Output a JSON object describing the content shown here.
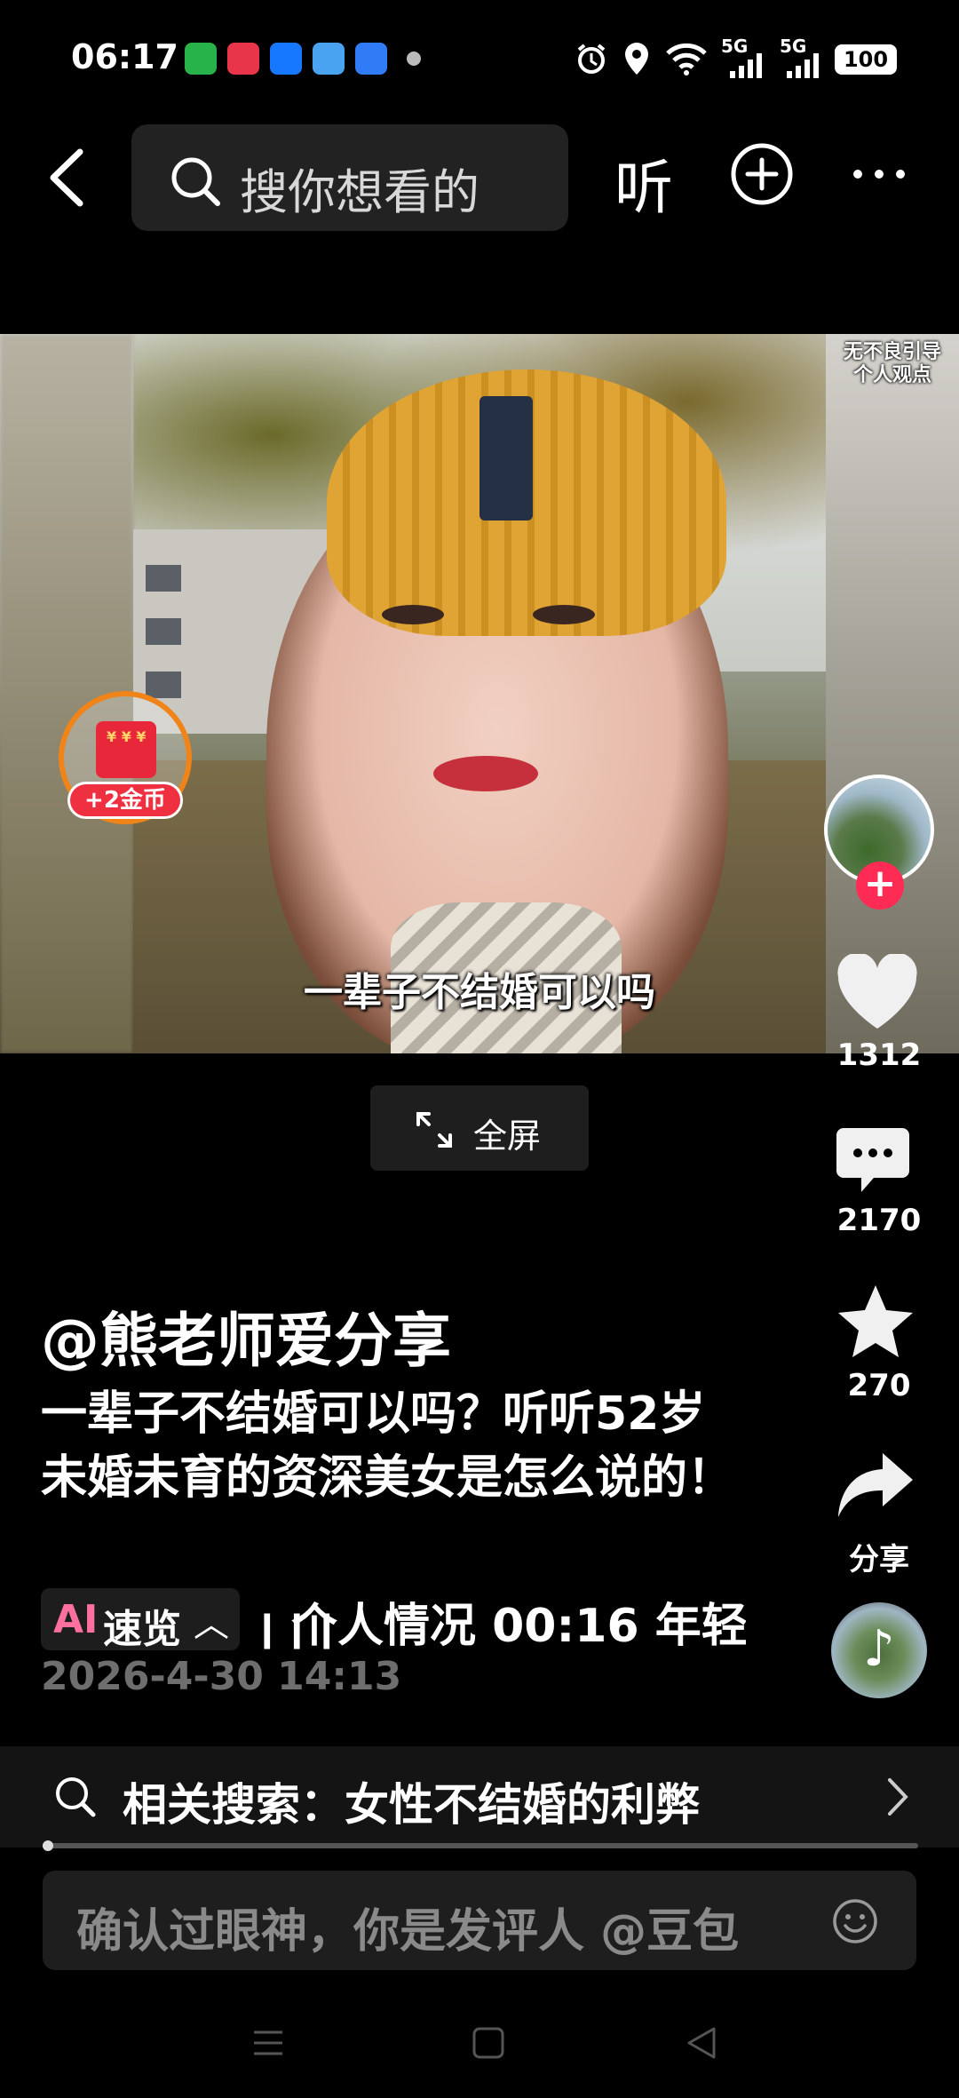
{
  "status_bar": {
    "time": "06:17",
    "battery": "100",
    "network_1": "5G",
    "network_2": "5G"
  },
  "header": {
    "search_placeholder": "搜你想看的",
    "listen_label": "听"
  },
  "video": {
    "subtitle": "一辈子不结婚可以吗",
    "disclaimer_line1": "无不良引导",
    "disclaimer_line2": "个人观点",
    "envelope_badge": "+2金币",
    "envelope_coins": "¥ ¥ ¥"
  },
  "fullscreen_button": {
    "label": "全屏"
  },
  "right_rail": {
    "likes": "1312",
    "comments": "2170",
    "favorites": "270",
    "share_label": "分享"
  },
  "post": {
    "author": "@熊老师爱分享",
    "description": "一辈子不结婚可以吗？听听52岁未婚未育的资深美女是怎么说的！",
    "ai_prefix": "AI",
    "ai_label": "速览",
    "chapters_text": "个人情况   00:16 年轻",
    "timestamp": "2026-4-30 14:13"
  },
  "related_search": {
    "text": "相关搜索：女性不结婚的利弊"
  },
  "playback": {
    "progress_fraction": 0.005
  },
  "comment_box": {
    "placeholder": "确认过眼神，你是发评人 @豆包"
  },
  "colors": {
    "accent": "#fe2c55",
    "envelope_ring": "#f08418",
    "background": "#000000"
  }
}
